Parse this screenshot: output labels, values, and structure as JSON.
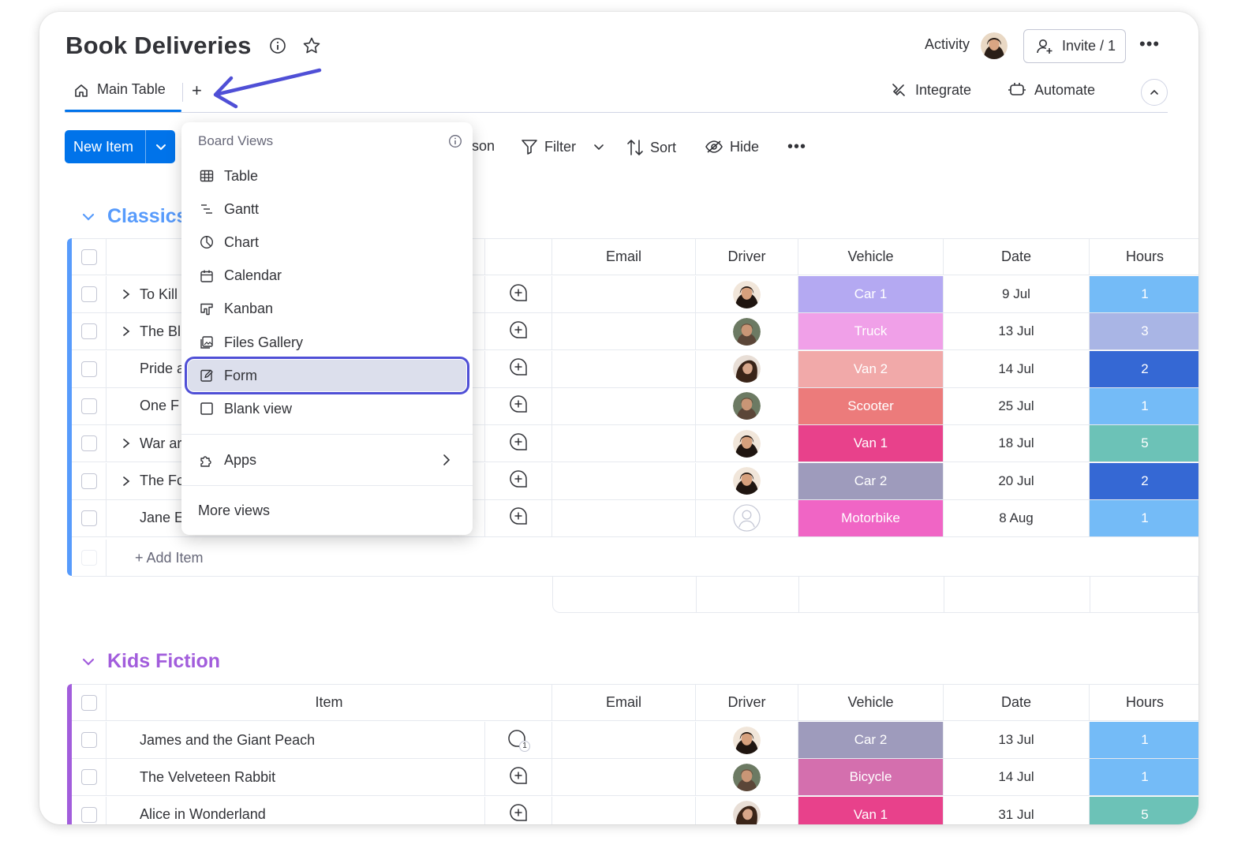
{
  "board": {
    "title": "Book Deliveries",
    "activity_label": "Activity",
    "invite_label": "Invite / 1"
  },
  "views": {
    "main_tab_label": "Main Table",
    "add_view_label": "+"
  },
  "header_actions": {
    "integrate_label": "Integrate",
    "automate_label": "Automate"
  },
  "toolbar": {
    "new_item_label": "New Item",
    "person_label_partial": "son",
    "filter_label": "Filter",
    "sort_label": "Sort",
    "hide_label": "Hide"
  },
  "dropdown": {
    "title": "Board Views",
    "items": [
      {
        "label": "Table",
        "icon": "table-icon"
      },
      {
        "label": "Gantt",
        "icon": "gantt-icon"
      },
      {
        "label": "Chart",
        "icon": "chart-icon"
      },
      {
        "label": "Calendar",
        "icon": "calendar-icon"
      },
      {
        "label": "Kanban",
        "icon": "kanban-icon"
      },
      {
        "label": "Files Gallery",
        "icon": "files-gallery-icon"
      },
      {
        "label": "Form",
        "icon": "form-icon",
        "selected": true
      },
      {
        "label": "Blank view",
        "icon": "blank-view-icon"
      }
    ],
    "apps_label": "Apps",
    "more_views_label": "More views"
  },
  "columns": {
    "item": "Item",
    "email": "Email",
    "driver": "Driver",
    "vehicle": "Vehicle",
    "date": "Date",
    "hours": "Hours"
  },
  "groups": [
    {
      "title": "Classics",
      "color": "#579bfc",
      "add_item_label": "+ Add Item",
      "rows": [
        {
          "item": "To Kill",
          "expandable": true,
          "driver": "avatar-1",
          "vehicle": "Car 1",
          "vehicle_color": "#b4a9f2",
          "date": "9 Jul",
          "hours": "1",
          "hours_color": "#74bbf7"
        },
        {
          "item": "The Bl",
          "expandable": true,
          "driver": "avatar-2",
          "vehicle": "Truck",
          "vehicle_color": "#f0a0e8",
          "date": "13 Jul",
          "hours": "3",
          "hours_color": "#a9b5e5"
        },
        {
          "item": "Pride a",
          "expandable": false,
          "driver": "avatar-3",
          "vehicle": "Van 2",
          "vehicle_color": "#f1a9a9",
          "date": "14 Jul",
          "hours": "2",
          "hours_color": "#3568d4"
        },
        {
          "item": "One F",
          "expandable": false,
          "driver": "avatar-2",
          "vehicle": "Scooter",
          "vehicle_color": "#ec7b7b",
          "date": "25 Jul",
          "hours": "1",
          "hours_color": "#74bbf7"
        },
        {
          "item": "War ar",
          "expandable": true,
          "driver": "avatar-1",
          "vehicle": "Van 1",
          "vehicle_color": "#e8418b",
          "date": "18 Jul",
          "hours": "5",
          "hours_color": "#6cc2b7"
        },
        {
          "item": "The Fc",
          "expandable": true,
          "driver": "avatar-1",
          "vehicle": "Car 2",
          "vehicle_color": "#9e9bbc",
          "date": "20 Jul",
          "hours": "2",
          "hours_color": "#3568d4"
        },
        {
          "item": "Jane E",
          "expandable": false,
          "driver": "empty",
          "vehicle": "Motorbike",
          "vehicle_color": "#f065c5",
          "date": "8 Aug",
          "hours": "1",
          "hours_color": "#74bbf7"
        }
      ]
    },
    {
      "title": "Kids Fiction",
      "color": "#a25ddc",
      "rows": [
        {
          "item": "James and the Giant Peach",
          "expandable": false,
          "updates": "1",
          "driver": "avatar-1",
          "vehicle": "Car 2",
          "vehicle_color": "#9e9bbc",
          "date": "13 Jul",
          "hours": "1",
          "hours_color": "#74bbf7"
        },
        {
          "item": "The Velveteen Rabbit",
          "expandable": false,
          "driver": "avatar-2",
          "vehicle": "Bicycle",
          "vehicle_color": "#d46fae",
          "date": "14 Jul",
          "hours": "1",
          "hours_color": "#74bbf7"
        },
        {
          "item": "Alice in Wonderland",
          "expandable": false,
          "driver": "avatar-3",
          "vehicle": "Van 1",
          "vehicle_color": "#e8418b",
          "date": "31 Jul",
          "hours": "5",
          "hours_color": "#6cc2b7"
        }
      ]
    }
  ],
  "colors": {
    "primary": "#0073ea",
    "arrow": "#4f4fd6",
    "selection_outline": "#4f4fd6"
  }
}
